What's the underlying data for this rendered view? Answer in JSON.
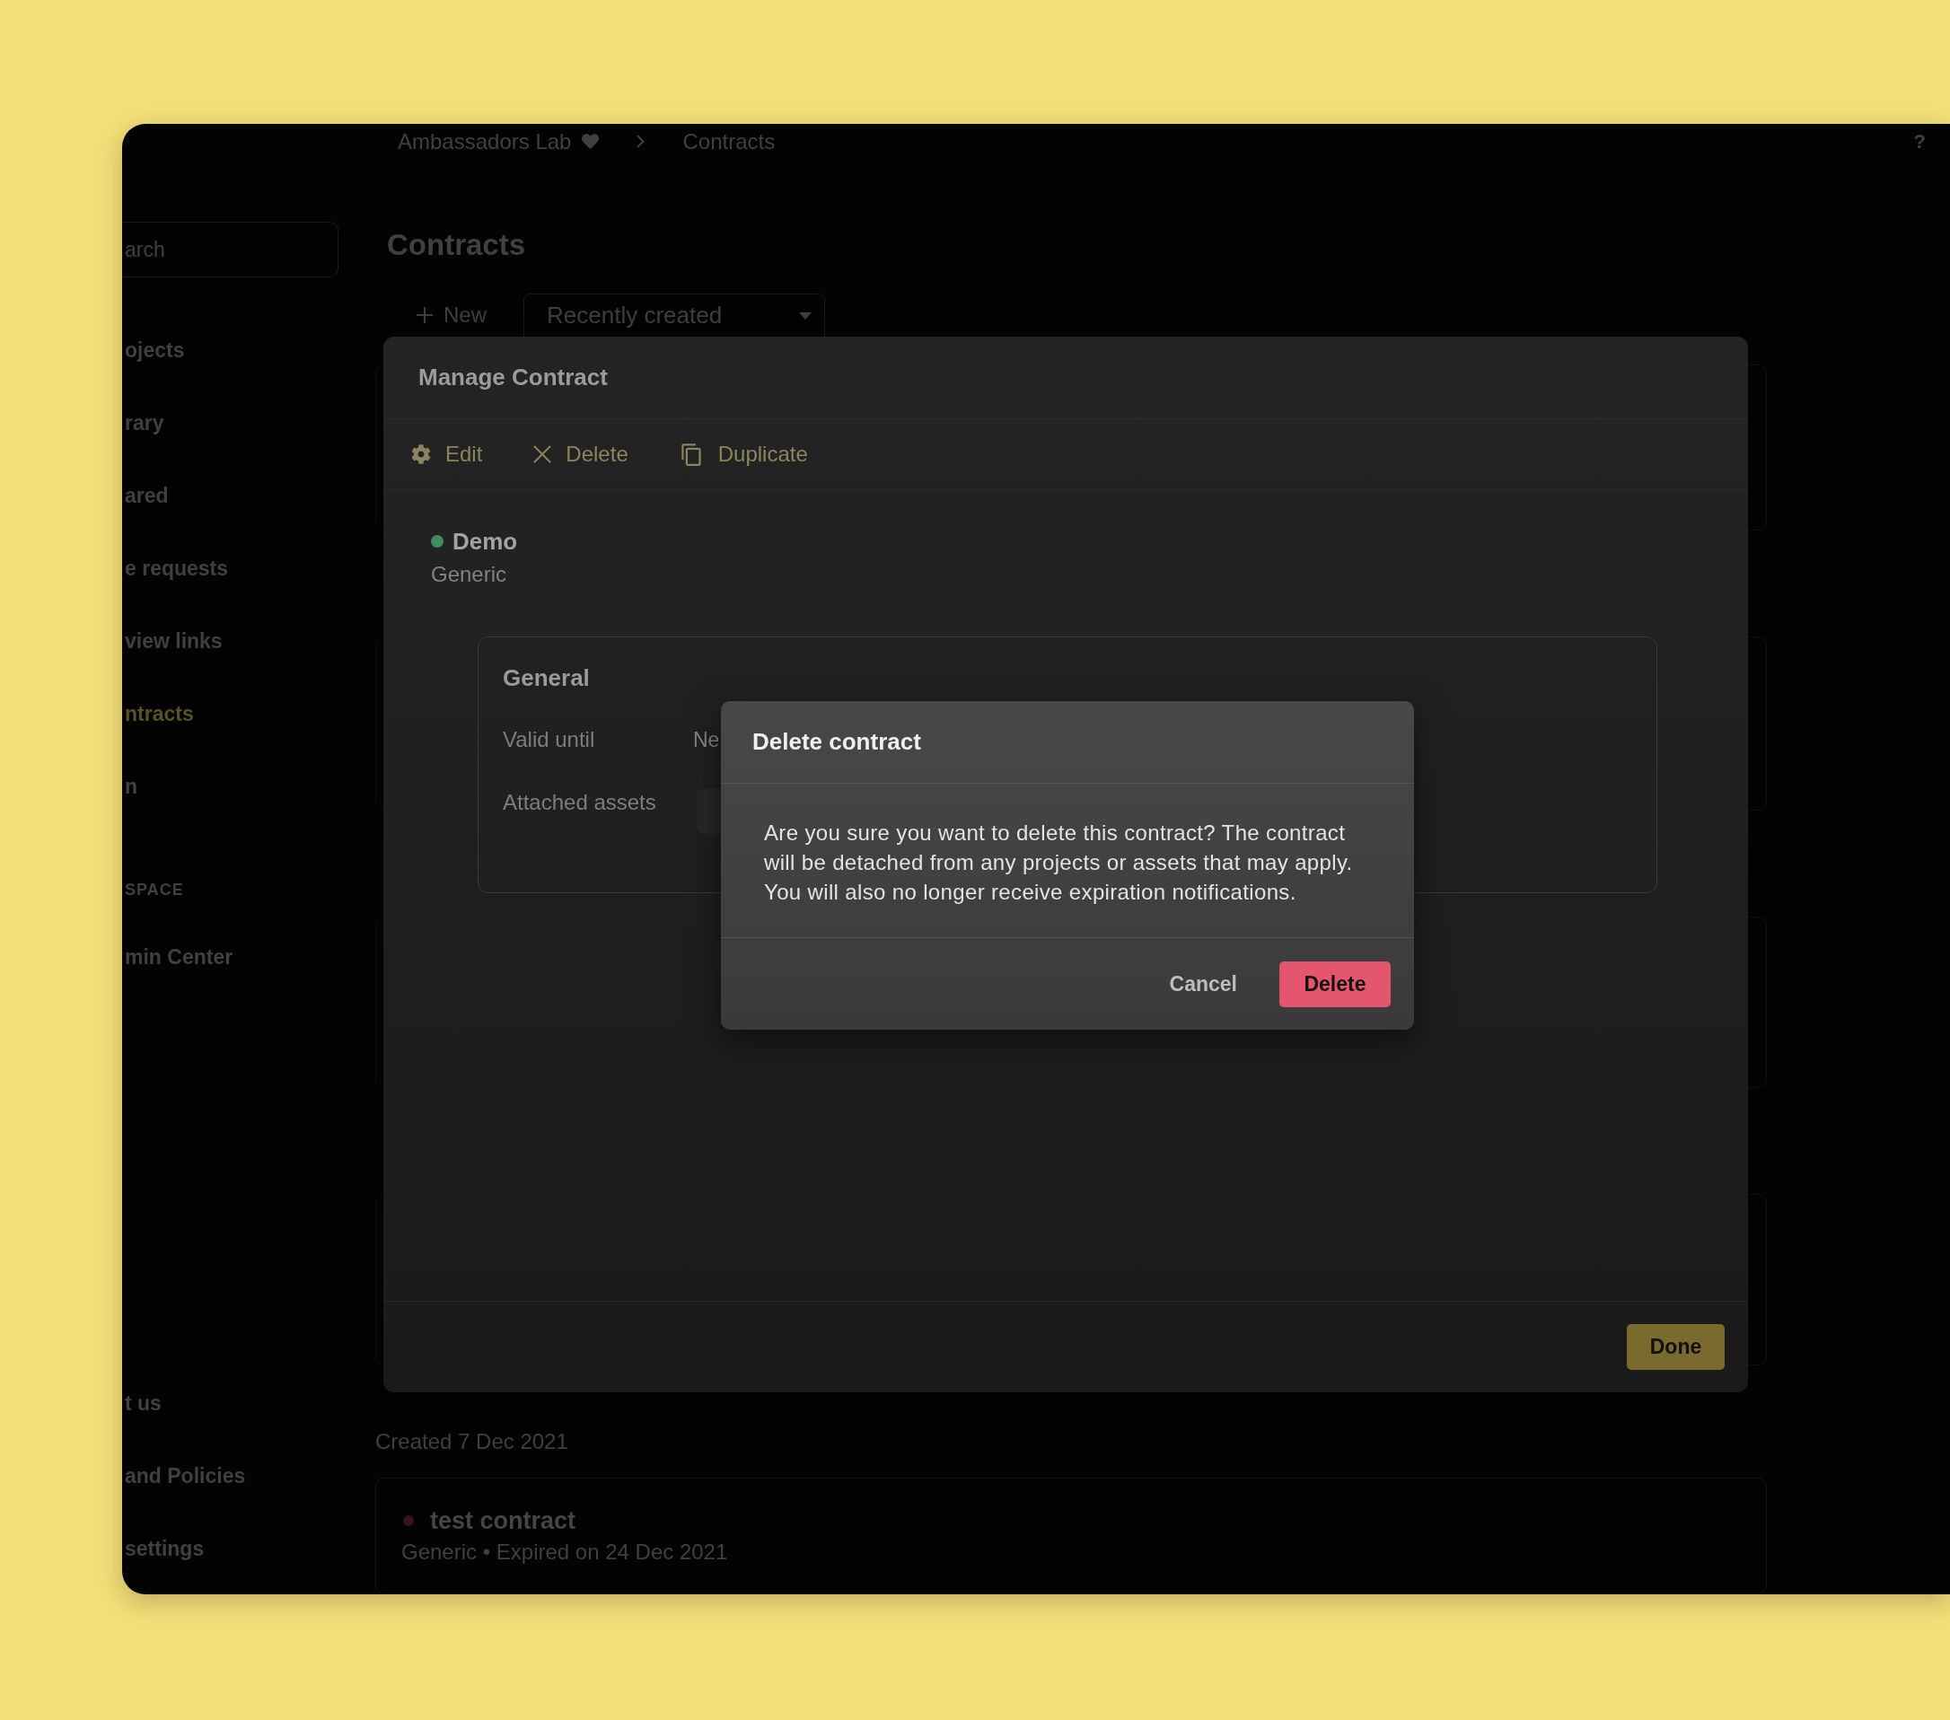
{
  "breadcrumb": {
    "items": [
      "Ambassadors Lab",
      "Contracts"
    ],
    "help": "?"
  },
  "sidebar": {
    "search": {
      "placeholder": "arch"
    },
    "items": [
      {
        "kind": "item",
        "label": "ojects",
        "selected": false
      },
      {
        "kind": "item",
        "label": "rary",
        "selected": false
      },
      {
        "kind": "item",
        "label": "ared",
        "selected": false
      },
      {
        "kind": "item",
        "label": "e requests",
        "selected": false
      },
      {
        "kind": "item",
        "label": "view links",
        "selected": false
      },
      {
        "kind": "item",
        "label": "ntracts",
        "selected": true
      },
      {
        "kind": "item",
        "label": "n",
        "selected": false
      },
      {
        "kind": "section",
        "label": "SPACE"
      },
      {
        "kind": "item",
        "label": "min Center",
        "selected": false
      }
    ],
    "footer_items": [
      {
        "label": "t us",
        "selected": false
      },
      {
        "label": "and Policies",
        "selected": false
      },
      {
        "label": "settings",
        "selected": false
      }
    ]
  },
  "page": {
    "title": "Contracts",
    "new_button": "New",
    "sort": {
      "value": "Recently created"
    }
  },
  "list": {
    "group_label": "Created 7 Dec 2021",
    "contract": {
      "name": "test contract",
      "color": "#3a121a",
      "meta": "Generic • Expired on 24 Dec 2021"
    }
  },
  "manage_modal": {
    "title": "Manage Contract",
    "actions": [
      {
        "kind": "edit",
        "label": "Edit"
      },
      {
        "kind": "delete",
        "label": "Delete"
      },
      {
        "kind": "duplicate",
        "label": "Duplicate"
      }
    ],
    "contract": {
      "name": "Demo",
      "color": "#3f8c5c",
      "type": "Generic"
    },
    "section": {
      "title": "General",
      "fields": [
        {
          "kind": "text",
          "label": "Valid until",
          "value": "Ne"
        },
        {
          "kind": "assets",
          "label": "Attached assets"
        }
      ]
    },
    "done_button": "Done"
  },
  "delete_dialog": {
    "title": "Delete contract",
    "message": "Are you sure you want to delete this contract? The contract will be detached from any projects or assets that may apply. You will also no longer receive expiration notifications.",
    "cancel_button": "Cancel",
    "confirm_button": "Delete"
  }
}
